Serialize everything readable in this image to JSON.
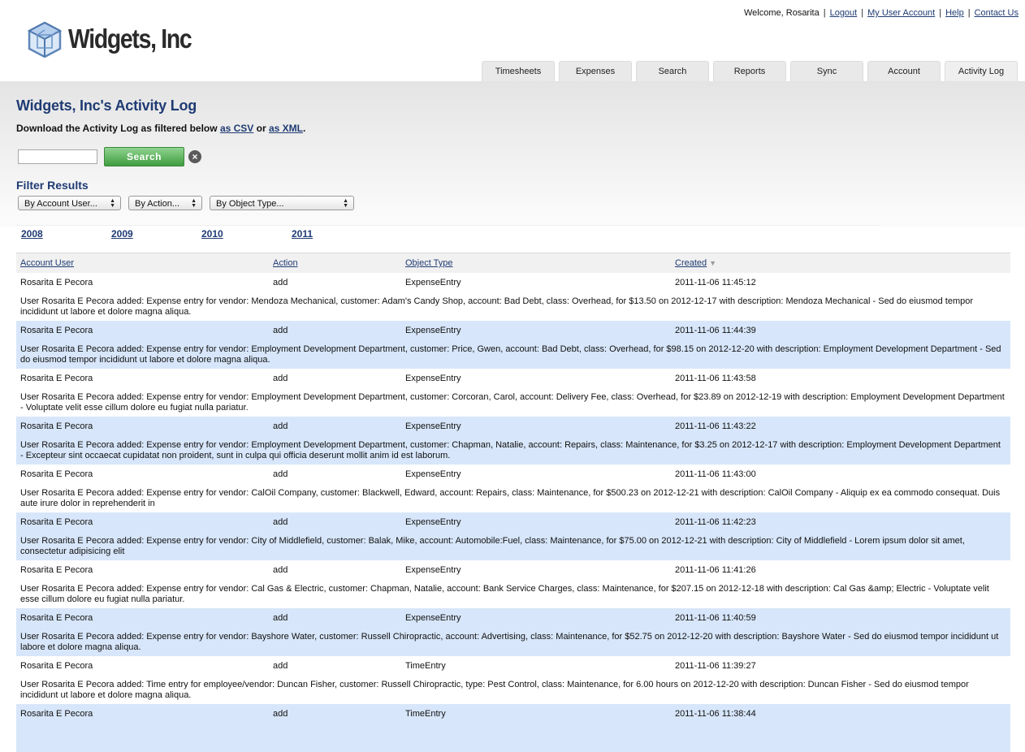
{
  "header": {
    "logo_text": "Widgets, Inc",
    "welcome": "Welcome, Rosarita",
    "links": [
      "Logout",
      "My User Account",
      "Help",
      "Contact Us"
    ],
    "tabs": [
      "Timesheets",
      "Expenses",
      "Search",
      "Reports",
      "Sync",
      "Account",
      "Activity Log"
    ],
    "active_tab": "Activity Log"
  },
  "page": {
    "title": "Widgets, Inc's Activity Log",
    "download_prefix": "Download the Activity Log as filtered below",
    "csv_link": "as CSV",
    "or_text": "or",
    "xml_link": "as XML",
    "period": "."
  },
  "search": {
    "value": "",
    "button_label": "Search",
    "clear_icon": "close-icon"
  },
  "filters": {
    "title": "Filter Results",
    "account_user": "By Account User...",
    "action": "By Action...",
    "object_type": "By Object Type..."
  },
  "years": [
    "2008",
    "2009",
    "2010",
    "2011"
  ],
  "table": {
    "headers": {
      "user": "Account User",
      "action": "Action",
      "object_type": "Object Type",
      "created": "Created"
    },
    "rows": [
      {
        "user": "Rosarita E Pecora",
        "action": "add",
        "object_type": "ExpenseEntry",
        "created": "2011-11-06 11:45:12",
        "description": "User Rosarita E Pecora added: Expense entry for vendor: Mendoza Mechanical, customer: Adam's Candy Shop, account: Bad Debt, class: Overhead, for $13.50 on 2012-12-17 with description: Mendoza Mechanical - Sed do eiusmod tempor incididunt ut labore et dolore magna aliqua."
      },
      {
        "user": "Rosarita E Pecora",
        "action": "add",
        "object_type": "ExpenseEntry",
        "created": "2011-11-06 11:44:39",
        "description": "User Rosarita E Pecora added: Expense entry for vendor: Employment Development Department, customer: Price, Gwen, account: Bad Debt, class: Overhead, for $98.15 on 2012-12-20 with description: Employment Development Department - Sed do eiusmod tempor incididunt ut labore et dolore magna aliqua."
      },
      {
        "user": "Rosarita E Pecora",
        "action": "add",
        "object_type": "ExpenseEntry",
        "created": "2011-11-06 11:43:58",
        "description": "User Rosarita E Pecora added: Expense entry for vendor: Employment Development Department, customer: Corcoran, Carol, account: Delivery Fee, class: Overhead, for $23.89 on 2012-12-19 with description: Employment Development Department - Voluptate velit esse cillum dolore eu fugiat nulla pariatur."
      },
      {
        "user": "Rosarita E Pecora",
        "action": "add",
        "object_type": "ExpenseEntry",
        "created": "2011-11-06 11:43:22",
        "description": "User Rosarita E Pecora added: Expense entry for vendor: Employment Development Department, customer: Chapman, Natalie, account: Repairs, class: Maintenance, for $3.25 on 2012-12-17 with description: Employment Development Department - Excepteur sint occaecat cupidatat non proident, sunt in culpa qui officia deserunt mollit anim id est laborum."
      },
      {
        "user": "Rosarita E Pecora",
        "action": "add",
        "object_type": "ExpenseEntry",
        "created": "2011-11-06 11:43:00",
        "description": "User Rosarita E Pecora added: Expense entry for vendor: CalOil Company, customer: Blackwell, Edward, account: Repairs, class: Maintenance, for $500.23 on 2012-12-21 with description: CalOil Company - Aliquip ex ea commodo consequat. Duis aute irure dolor in reprehenderit in"
      },
      {
        "user": "Rosarita E Pecora",
        "action": "add",
        "object_type": "ExpenseEntry",
        "created": "2011-11-06 11:42:23",
        "description": "User Rosarita E Pecora added: Expense entry for vendor: City of Middlefield, customer: Balak, Mike, account: Automobile:Fuel, class: Maintenance, for $75.00 on 2012-12-21 with description: City of Middlefield - Lorem ipsum dolor sit amet, consectetur adipisicing elit"
      },
      {
        "user": "Rosarita E Pecora",
        "action": "add",
        "object_type": "ExpenseEntry",
        "created": "2011-11-06 11:41:26",
        "description": "User Rosarita E Pecora added: Expense entry for vendor: Cal Gas & Electric, customer: Chapman, Natalie, account: Bank Service Charges, class: Maintenance, for $207.15 on 2012-12-18 with description: Cal Gas &amp; Electric - Voluptate velit esse cillum dolore eu fugiat nulla pariatur."
      },
      {
        "user": "Rosarita E Pecora",
        "action": "add",
        "object_type": "ExpenseEntry",
        "created": "2011-11-06 11:40:59",
        "description": "User Rosarita E Pecora added: Expense entry for vendor: Bayshore Water, customer: Russell Chiropractic, account: Advertising, class: Maintenance, for $52.75 on 2012-12-20 with description: Bayshore Water - Sed do eiusmod tempor incididunt ut labore et dolore magna aliqua."
      },
      {
        "user": "Rosarita E Pecora",
        "action": "add",
        "object_type": "TimeEntry",
        "created": "2011-11-06 11:39:27",
        "description": "User Rosarita E Pecora added: Time entry for employee/vendor: Duncan Fisher, customer: Russell Chiropractic, type: Pest Control, class: Maintenance, for 6.00 hours on 2012-12-20 with description: Duncan Fisher - Sed do eiusmod tempor incididunt ut labore et dolore magna aliqua."
      },
      {
        "user": "Rosarita E Pecora",
        "action": "add",
        "object_type": "TimeEntry",
        "created": "2011-11-06 11:38:44",
        "description": ""
      }
    ]
  }
}
